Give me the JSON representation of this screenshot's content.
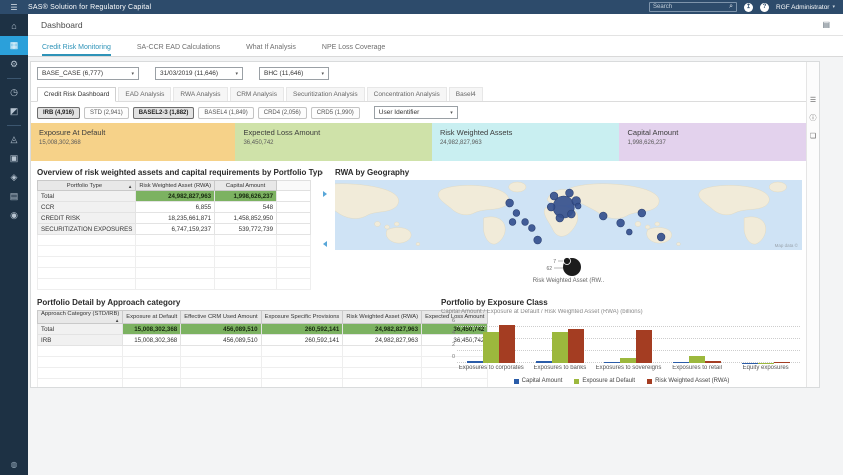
{
  "app": {
    "title": "SAS® Solution for Regulatory Capital",
    "search_placeholder": "Search",
    "user": "RGF Administrator"
  },
  "icons": {
    "menu": "☰",
    "search": "⌕",
    "notifications": "↥",
    "help": "?",
    "caret": "▾",
    "report": "▤"
  },
  "page": {
    "title": "Dashboard"
  },
  "nav_tabs": [
    {
      "label": "Credit Risk Monitoring",
      "active": true
    },
    {
      "label": "SA-CCR EAD Calculations",
      "active": false
    },
    {
      "label": "What If Analysis",
      "active": false
    },
    {
      "label": "NPE Loss Coverage",
      "active": false
    }
  ],
  "sidebar": {
    "items": [
      {
        "name": "home",
        "glyph": "⌂"
      },
      {
        "name": "dashboard",
        "glyph": "▦",
        "active": true
      },
      {
        "name": "settings",
        "glyph": "⚙"
      },
      {
        "divider": true
      },
      {
        "name": "history",
        "glyph": "◷"
      },
      {
        "name": "analytics",
        "glyph": "◩"
      },
      {
        "divider": true
      },
      {
        "name": "models",
        "glyph": "◬"
      },
      {
        "name": "folders",
        "glyph": "▣"
      },
      {
        "name": "tags",
        "glyph": "◈"
      },
      {
        "name": "reports",
        "glyph": "▤"
      },
      {
        "name": "workflow",
        "glyph": "◉"
      }
    ],
    "bottom": {
      "name": "status",
      "glyph": "◍"
    }
  },
  "filters": [
    "BASE_CASE (6,777)",
    "31/03/2019 (11,646)",
    "BHC (11,646)"
  ],
  "inner_tabs": [
    {
      "label": "Credit Risk Dashboard",
      "active": true
    },
    {
      "label": "EAD Analysis",
      "active": false
    },
    {
      "label": "RWA Analysis",
      "active": false
    },
    {
      "label": "CRM Analysis",
      "active": false
    },
    {
      "label": "Securitization Analysis",
      "active": false
    },
    {
      "label": "Concentration Analysis",
      "active": false
    },
    {
      "label": "Basel4",
      "active": false
    }
  ],
  "toggles": [
    {
      "label": "IRB (4,916)",
      "selected": true
    },
    {
      "label": "STD (2,941)",
      "selected": false
    },
    {
      "label": "BASEL2-3 (1,882)",
      "selected": true
    },
    {
      "label": "BASEL4 (1,849)",
      "selected": false
    },
    {
      "label": "CRD4 (2,056)",
      "selected": false
    },
    {
      "label": "CRD5 (1,990)",
      "selected": false
    }
  ],
  "user_identifier_select": "User Identifier",
  "kpis": [
    {
      "label": "Exposure At Default",
      "value": "15,008,302,368",
      "color": "#f6d289"
    },
    {
      "label": "Expected Loss Amount",
      "value": "36,450,742",
      "color": "#cfe2a9"
    },
    {
      "label": "Risk Weighted Assets",
      "value": "24,982,827,963",
      "color": "#c9eff1"
    },
    {
      "label": "Capital Amount",
      "value": "1,998,626,237",
      "color": "#e3d2ed"
    }
  ],
  "overview_table": {
    "title": "Overview of risk weighted assets and capital requirements by Portfolio Type",
    "sort_icon": "▲",
    "columns": [
      "Portfolio Type",
      "Risk Weighted Asset (RWA)",
      "Capital Amount"
    ],
    "rows": [
      {
        "cells": [
          "Total",
          "24,982,827,963",
          "1,998,626,237"
        ],
        "highlight": true
      },
      {
        "cells": [
          "CCR",
          "6,855",
          "548"
        ],
        "highlight": false
      },
      {
        "cells": [
          "CREDIT RISK",
          "18,235,661,871",
          "1,458,852,950"
        ],
        "highlight": false
      },
      {
        "cells": [
          "SECURITIZATION EXPOSURES",
          "6,747,159,237",
          "539,772,739"
        ],
        "highlight": false
      }
    ]
  },
  "map": {
    "title": "RWA by Geography",
    "legend": {
      "small_value": "7",
      "large_value": "62",
      "label": "Risk Weighted Asset (RW.."
    },
    "attribution": "Map data ©",
    "bubbles": [
      {
        "x": 181,
        "y": 23,
        "r": 4
      },
      {
        "x": 188,
        "y": 33,
        "r": 3.5
      },
      {
        "x": 184,
        "y": 42,
        "r": 3.5
      },
      {
        "x": 197,
        "y": 42,
        "r": 3.5
      },
      {
        "x": 204,
        "y": 48,
        "r": 3.5
      },
      {
        "x": 210,
        "y": 60,
        "r": 4
      },
      {
        "x": 237,
        "y": 27,
        "r": 11
      },
      {
        "x": 227,
        "y": 16,
        "r": 4
      },
      {
        "x": 243,
        "y": 13,
        "r": 4
      },
      {
        "x": 250,
        "y": 21,
        "r": 4.5
      },
      {
        "x": 224,
        "y": 27,
        "r": 4
      },
      {
        "x": 233,
        "y": 38,
        "r": 4
      },
      {
        "x": 245,
        "y": 34,
        "r": 4
      },
      {
        "x": 252,
        "y": 26,
        "r": 3
      },
      {
        "x": 278,
        "y": 36,
        "r": 4
      },
      {
        "x": 296,
        "y": 43,
        "r": 4
      },
      {
        "x": 318,
        "y": 33,
        "r": 4
      },
      {
        "x": 305,
        "y": 52,
        "r": 3
      },
      {
        "x": 338,
        "y": 57,
        "r": 4
      }
    ]
  },
  "detail_table": {
    "title": "Portfolio Detail by Approach category",
    "sort_icon": "▲",
    "columns": [
      "Approach Category (STD/IRB)",
      "Exposure at Default",
      "Effective CRM Used Amount",
      "Exposure Specific Provisions",
      "Risk Weighted Asset (RWA)",
      "Expected Loss Amount"
    ],
    "rows": [
      {
        "cells": [
          "Total",
          "15,008,302,368",
          "456,089,510",
          "260,592,141",
          "24,982,827,963",
          "36,450,742"
        ],
        "highlight": true
      },
      {
        "cells": [
          "IRB",
          "15,008,302,368",
          "456,089,510",
          "260,592,141",
          "24,982,827,963",
          "36,450,742"
        ],
        "highlight": false
      }
    ]
  },
  "chart_data": {
    "type": "bar",
    "title": "Portfolio by Exposure Class",
    "subtitle": "Capital Amount / Exposure at Default / Risk Weighted Asset (RWA) (billions)",
    "categories": [
      "Exposures to corporates",
      "Exposures to banks",
      "Exposures to sovereigns",
      "Exposures to retail",
      "Equity exposures"
    ],
    "series": [
      {
        "name": "Capital Amount",
        "color": "#2a5ca8",
        "values": [
          0.4,
          0.3,
          0.25,
          0.1,
          0.02
        ]
      },
      {
        "name": "Exposure at Default",
        "color": "#9cb83d",
        "values": [
          5.2,
          5.1,
          0.85,
          1.2,
          0.05
        ]
      },
      {
        "name": "Risk Weighted Asset (RWA)",
        "color": "#a43d22",
        "values": [
          6.3,
          5.6,
          5.5,
          0.3,
          0.2
        ]
      }
    ],
    "yticks": [
      0,
      2,
      4,
      6
    ],
    "ylim": [
      0,
      6.6
    ],
    "grid": "dotted",
    "legend_position": "bottom"
  },
  "rail_icons": [
    {
      "name": "rail-menu",
      "glyph": "☰"
    },
    {
      "name": "info",
      "glyph": "ⓘ"
    },
    {
      "name": "comment",
      "glyph": "❏"
    }
  ]
}
